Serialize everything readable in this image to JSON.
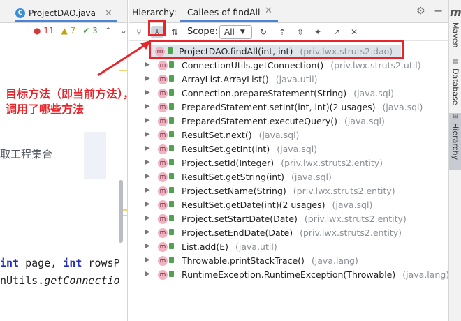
{
  "editor": {
    "tab_label": "ProjectDAO.java",
    "tab_icon": "C",
    "inspections": {
      "errors": "11",
      "warnings": "7",
      "ok": "3"
    },
    "side_text": "取工程集合",
    "code_line1_kw1": "int",
    "code_line1_mid": " page, ",
    "code_line1_kw2": "int",
    "code_line1_tail": " rowsP",
    "code_line2": "nUtils.",
    "code_line2_it": "getConnectio"
  },
  "hierarchy": {
    "title": "Hierarchy:",
    "tab_label": "Callees of findAll",
    "scope_label": "Scope:",
    "scope_value": "All"
  },
  "tree": [
    {
      "label": "ProjectDAO.findAll(int, int)",
      "pkg": "(priv.lwx.struts2.dao)"
    },
    {
      "label": "ConnectionUtils.getConnection()",
      "pkg": "(priv.lwx.struts2.util)"
    },
    {
      "label": "ArrayList.ArrayList()",
      "pkg": "(java.util)"
    },
    {
      "label": "Connection.prepareStatement(String)",
      "pkg": "(java.sql)"
    },
    {
      "label": "PreparedStatement.setInt(int, int)(2 usages)",
      "pkg": "(java.sql)"
    },
    {
      "label": "PreparedStatement.executeQuery()",
      "pkg": "(java.sql)"
    },
    {
      "label": "ResultSet.next()",
      "pkg": "(java.sql)"
    },
    {
      "label": "ResultSet.getInt(int)",
      "pkg": "(java.sql)"
    },
    {
      "label": "Project.setId(Integer)",
      "pkg": "(priv.lwx.struts2.entity)"
    },
    {
      "label": "ResultSet.getString(int)",
      "pkg": "(java.sql)"
    },
    {
      "label": "Project.setName(String)",
      "pkg": "(priv.lwx.struts2.entity)"
    },
    {
      "label": "ResultSet.getDate(int)(2 usages)",
      "pkg": "(java.sql)"
    },
    {
      "label": "Project.setStartDate(Date)",
      "pkg": "(priv.lwx.struts2.entity)"
    },
    {
      "label": "Project.setEndDate(Date)",
      "pkg": "(priv.lwx.struts2.entity)"
    },
    {
      "label": "List.add(E)",
      "pkg": "(java.util)"
    },
    {
      "label": "Throwable.printStackTrace()",
      "pkg": "(java.lang)"
    },
    {
      "label": "RuntimeException.RuntimeException(Throwable)",
      "pkg": "(java.lang)"
    }
  ],
  "sidebar": {
    "letter": "m",
    "items": [
      "Maven",
      "Database",
      "Hierarchy"
    ]
  },
  "annotation": {
    "line1": "目标方法（即当前方法），",
    "line2": "调用了哪些方法"
  },
  "colors": {
    "accent": "#4a84d4",
    "annotation": "#e8252b",
    "selection": "#dfe3ea"
  }
}
